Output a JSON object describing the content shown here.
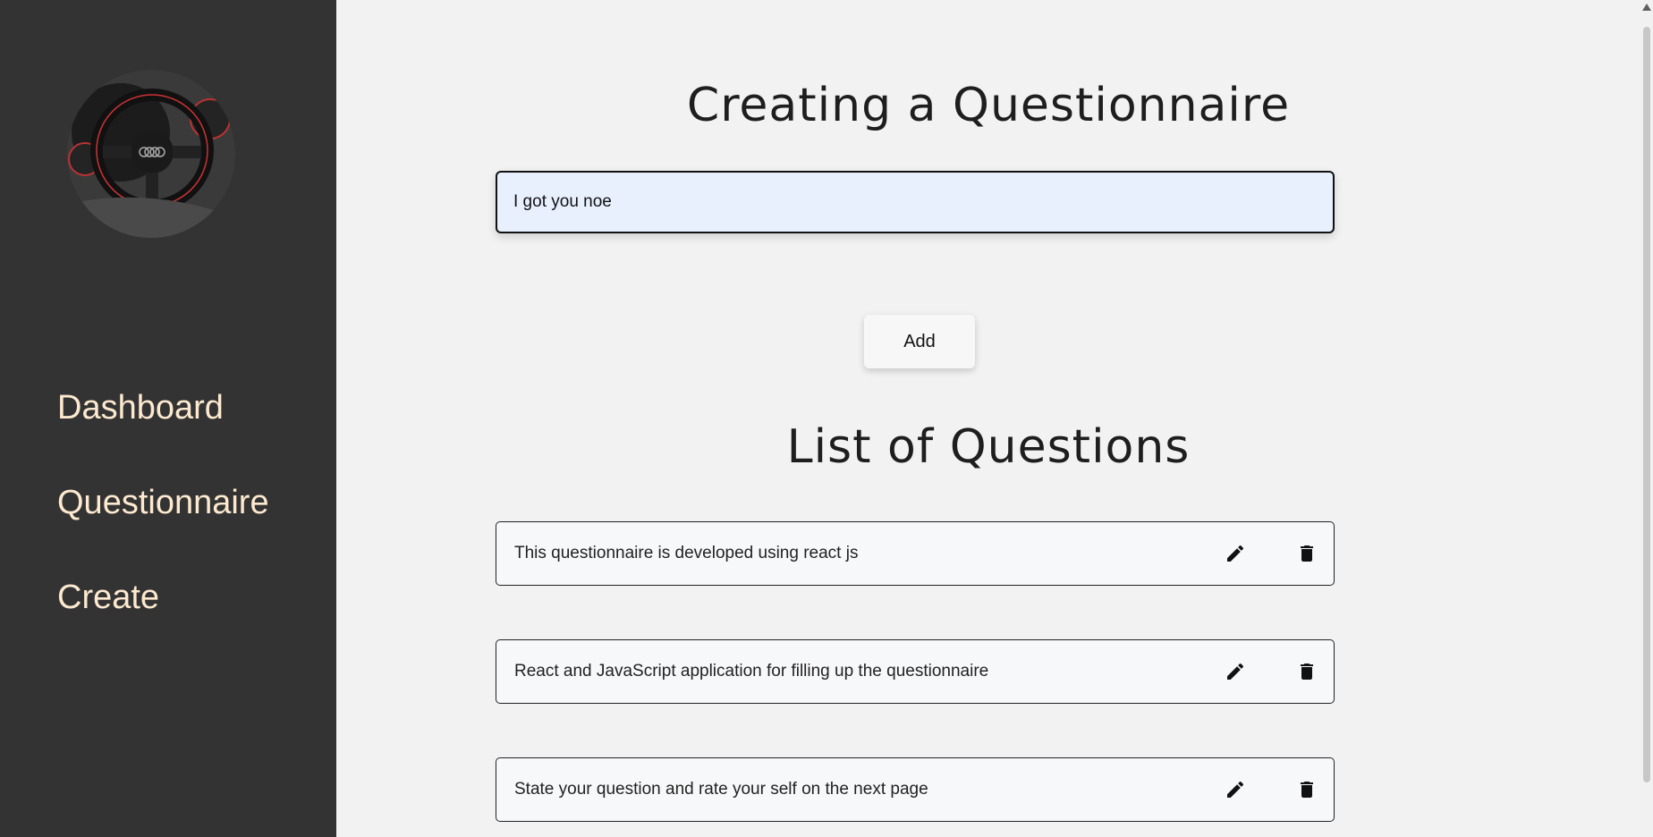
{
  "sidebar": {
    "avatar_icon": "steering-wheel-photo",
    "items": [
      {
        "label": "Dashboard"
      },
      {
        "label": "Questionnaire"
      },
      {
        "label": "Create"
      }
    ]
  },
  "main": {
    "create_title": "Creating a Questionnaire",
    "question_input_value": "I got you noe",
    "add_label": "Add",
    "list_title": "List of Questions",
    "questions": [
      {
        "text": "This questionnaire is developed using react js",
        "edit_icon": "pencil-icon",
        "delete_icon": "trash-icon"
      },
      {
        "text": "React and JavaScript application for filling up the questionnaire",
        "edit_icon": "pencil-icon",
        "delete_icon": "trash-icon"
      },
      {
        "text": "State your question and rate your self on the next page",
        "edit_icon": "pencil-icon",
        "delete_icon": "trash-icon"
      }
    ]
  },
  "colors": {
    "sidebar_bg": "#333333",
    "nav_text": "#fce9cf",
    "page_bg": "#f2f2f2",
    "input_bg": "#e8f0fe"
  }
}
